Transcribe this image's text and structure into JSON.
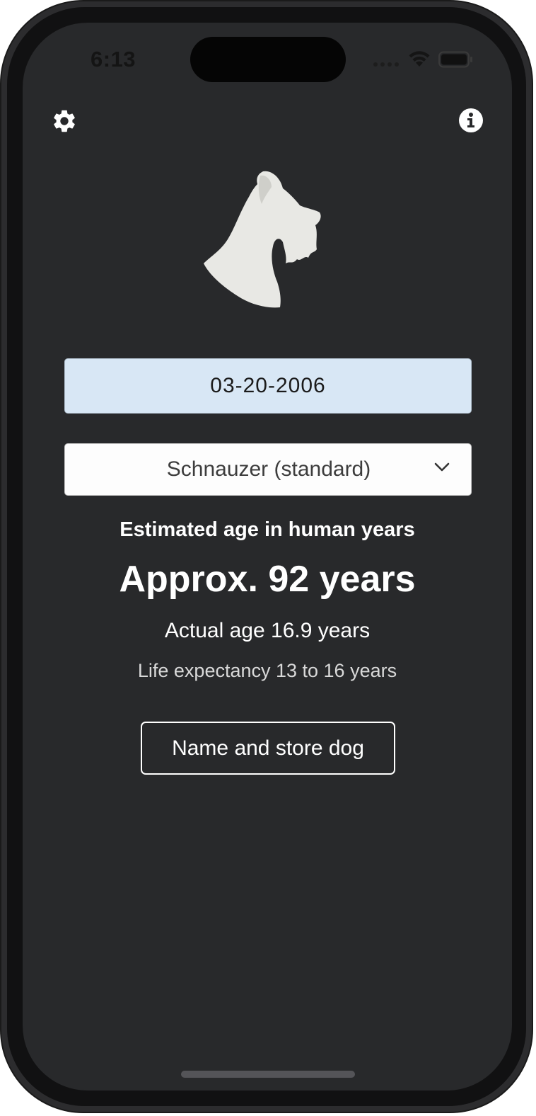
{
  "status_bar": {
    "time": "6:13"
  },
  "header": {
    "left_icon": "gear-icon",
    "right_icon": "info-icon"
  },
  "logo": {
    "icon": "schnauzer-head-icon",
    "color": "#e8e8e4"
  },
  "birth_date": {
    "value": "03-20-2006"
  },
  "breed_select": {
    "selected": "Schnauzer (standard)"
  },
  "result": {
    "label": "Estimated age in human years",
    "human_age": "Approx. 92 years",
    "actual_age": "Actual age 16.9 years",
    "life_expectancy": "Life expectancy 13 to 16 years"
  },
  "actions": {
    "store_label": "Name and store dog"
  },
  "theme": {
    "background": "#28292b",
    "date_field_bg": "#d8e7f5"
  }
}
